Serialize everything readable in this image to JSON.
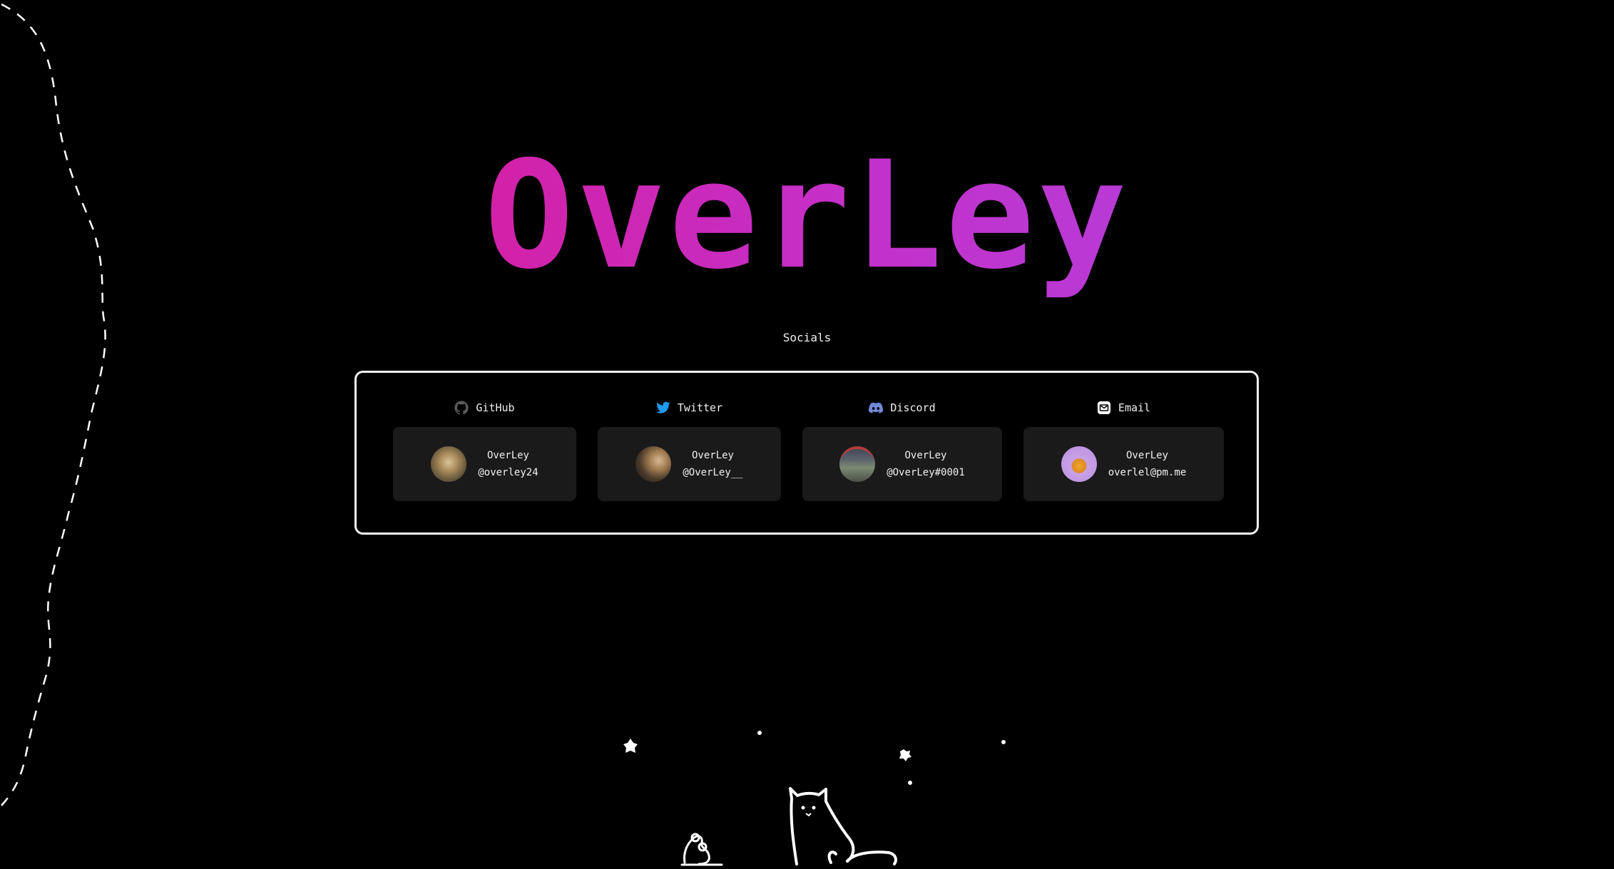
{
  "brand": {
    "title": "OverLey"
  },
  "socials": {
    "heading": "Socials",
    "items": [
      {
        "platform": "GitHub",
        "icon": "github-icon",
        "name": "OverLey",
        "handle": "@overley24"
      },
      {
        "platform": "Twitter",
        "icon": "twitter-bird-icon",
        "name": "OverLey",
        "handle": "@OverLey__"
      },
      {
        "platform": "Discord",
        "icon": "discord-icon",
        "name": "OverLey",
        "handle": "@OverLey#0001"
      },
      {
        "platform": "Email",
        "icon": "envelope-icon",
        "name": "OverLey",
        "handle": "overlel@pm.me"
      }
    ]
  },
  "colors": {
    "background": "#000000",
    "title_gradient_start": "#d321a8",
    "title_gradient_end": "#b83ad6",
    "card_background": "#1a1a1a",
    "panel_border": "#f2f2f2",
    "twitter_blue": "#1d9bf0",
    "discord_blurple": "#7289da"
  }
}
